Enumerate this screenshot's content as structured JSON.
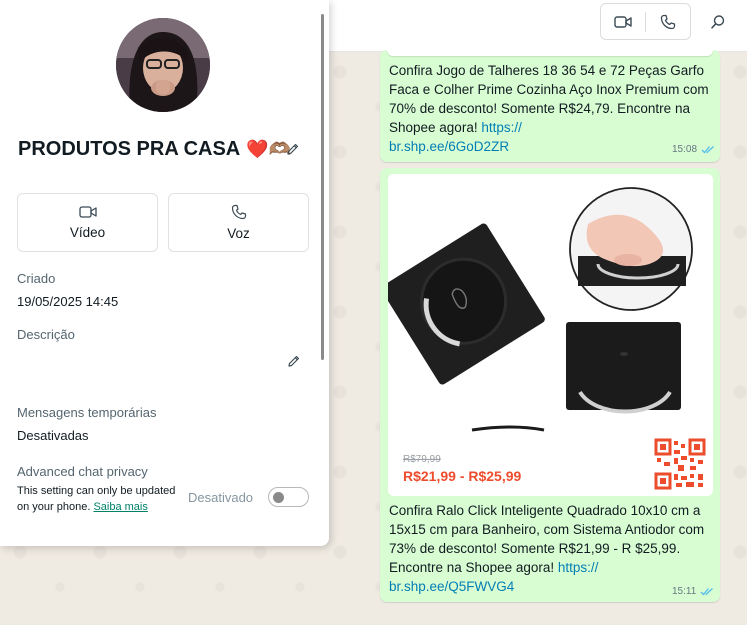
{
  "chat": {
    "header": {
      "video_call_icon": "video-icon",
      "voice_call_icon": "phone-icon",
      "search_icon": "search-icon"
    },
    "messages": [
      {
        "text": "Confira Jogo de Talheres 18 36 54 e 72 Peças Garfo Faca e Colher Prime Cozinha Aço Inox Premium com 70% de desconto! Somente R$24,79. Encontre na Shopee agora! ",
        "link": "https://\nbr.shp.ee/6GoD2ZR",
        "time": "15:08"
      },
      {
        "preview": {
          "old_price": "R$79,99",
          "price_range": "R$21,99 - R$25,99"
        },
        "text": "Confira Ralo Click Inteligente Quadrado 10x10 cm a 15x15 cm para Banheiro, com Sistema Antiodor com 73% de desconto! Somente R$21,99 - R $25,99. Encontre na Shopee agora! ",
        "link": "https://\nbr.shp.ee/Q5FWVG4",
        "time": "15:11"
      }
    ],
    "colors": {
      "outgoing_bubble": "#d9fdd3",
      "link": "#027eb5",
      "shopee_orange": "#ee4d2d"
    }
  },
  "panel": {
    "group_name": "PRODUTOS PRA CASA",
    "group_emoji": "❤️🫶🏽",
    "actions": [
      {
        "label": "Vídeo",
        "icon": "video-icon"
      },
      {
        "label": "Voz",
        "icon": "phone-icon"
      }
    ],
    "created_label": "Criado",
    "created_value": "19/05/2025 14:45",
    "description_label": "Descrição",
    "disappearing_label": "Mensagens temporárias",
    "disappearing_value": "Desativadas",
    "privacy_label": "Advanced chat privacy",
    "privacy_note": "This setting can only be updated on your phone. ",
    "privacy_link": "Saiba mais",
    "privacy_toggle_label": "Desativado",
    "privacy_toggle_on": false
  }
}
